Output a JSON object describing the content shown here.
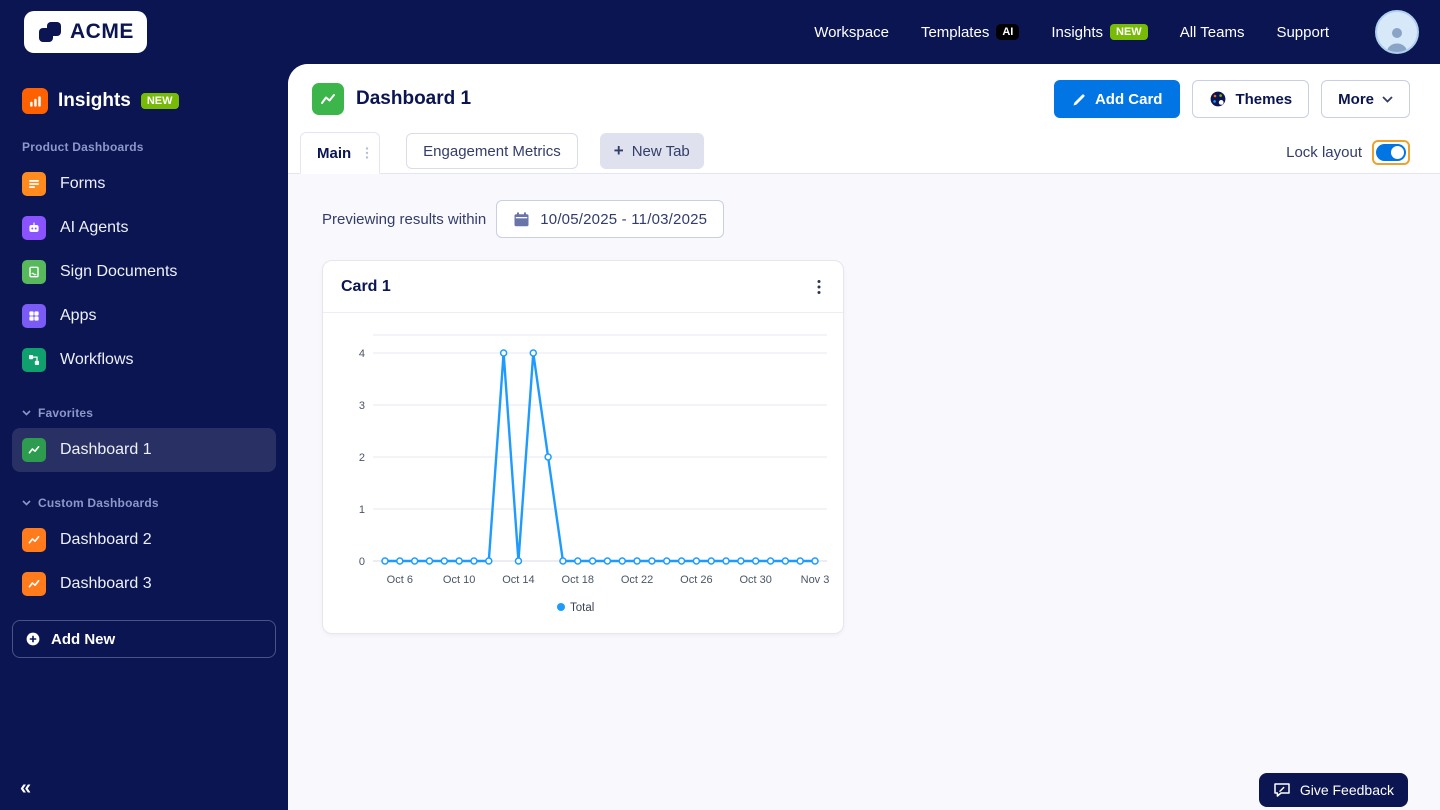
{
  "colors": {
    "navy": "#0A1551",
    "accent_blue": "#0075E3",
    "chart_blue": "#1E9BFF",
    "badge_green": "#78BB07",
    "toggle_focus_ring": "#EDA12F",
    "panel_bg": "#F8F8FD"
  },
  "brand": {
    "logo_text": "ACME"
  },
  "top_nav": {
    "items": [
      {
        "label": "Workspace"
      },
      {
        "label": "Templates",
        "badge": "AI"
      },
      {
        "label": "Insights",
        "badge": "NEW"
      },
      {
        "label": "All Teams"
      },
      {
        "label": "Support"
      }
    ]
  },
  "sidebar": {
    "app_title": "Insights",
    "app_badge": "NEW",
    "sections": {
      "product": "Product Dashboards",
      "favorites": "Favorites",
      "custom": "Custom Dashboards"
    },
    "product_items": [
      {
        "label": "Forms",
        "icon": "forms-icon",
        "color": "#FF8A1E"
      },
      {
        "label": "AI Agents",
        "icon": "ai-agents-icon",
        "color": "#8A53FF"
      },
      {
        "label": "Sign Documents",
        "icon": "sign-documents-icon",
        "color": "#58B85C"
      },
      {
        "label": "Apps",
        "icon": "apps-icon",
        "color": "#7B5BF5"
      },
      {
        "label": "Workflows",
        "icon": "workflows-icon",
        "color": "#0FA06E"
      }
    ],
    "favorites_items": [
      {
        "label": "Dashboard 1",
        "icon": "dashboard-icon",
        "color": "#2E9C4F",
        "selected": true
      }
    ],
    "custom_items": [
      {
        "label": "Dashboard 2",
        "icon": "dashboard-icon",
        "color": "#FF7B1B"
      },
      {
        "label": "Dashboard 3",
        "icon": "dashboard-icon",
        "color": "#FF7B1B"
      }
    ],
    "add_new_label": "Add New"
  },
  "dashboard": {
    "title": "Dashboard 1",
    "buttons": {
      "add_card": "Add Card",
      "themes": "Themes",
      "more": "More"
    },
    "tabs": [
      {
        "label": "Main",
        "active": true
      },
      {
        "label": "Engagement Metrics",
        "active": false
      }
    ],
    "new_tab_label": "New Tab",
    "lock_layout_label": "Lock layout",
    "lock_layout_on": true,
    "preview_label": "Previewing results within",
    "date_range": "10/05/2025 - 11/03/2025"
  },
  "card": {
    "title": "Card 1"
  },
  "chart_data": {
    "type": "line",
    "title": "Card 1",
    "x": [
      "Oct 5",
      "Oct 6",
      "Oct 7",
      "Oct 8",
      "Oct 9",
      "Oct 10",
      "Oct 11",
      "Oct 12",
      "Oct 13",
      "Oct 14",
      "Oct 15",
      "Oct 16",
      "Oct 17",
      "Oct 18",
      "Oct 19",
      "Oct 20",
      "Oct 21",
      "Oct 22",
      "Oct 23",
      "Oct 24",
      "Oct 25",
      "Oct 26",
      "Oct 27",
      "Oct 28",
      "Oct 29",
      "Oct 30",
      "Oct 31",
      "Nov 1",
      "Nov 2",
      "Nov 3"
    ],
    "series": [
      {
        "name": "Total",
        "color": "#1E9BFF",
        "values": [
          0,
          0,
          0,
          0,
          0,
          0,
          0,
          0,
          4,
          0,
          4,
          2,
          0,
          0,
          0,
          0,
          0,
          0,
          0,
          0,
          0,
          0,
          0,
          0,
          0,
          0,
          0,
          0,
          0,
          0
        ]
      }
    ],
    "x_ticks": [
      "Oct 6",
      "Oct 10",
      "Oct 14",
      "Oct 18",
      "Oct 22",
      "Oct 26",
      "Oct 30",
      "Nov 3"
    ],
    "y_ticks": [
      0,
      1,
      2,
      3,
      4
    ],
    "ylim": [
      0,
      4.4
    ],
    "grid": true,
    "legend_position": "bottom"
  },
  "feedback": {
    "label": "Give Feedback"
  }
}
